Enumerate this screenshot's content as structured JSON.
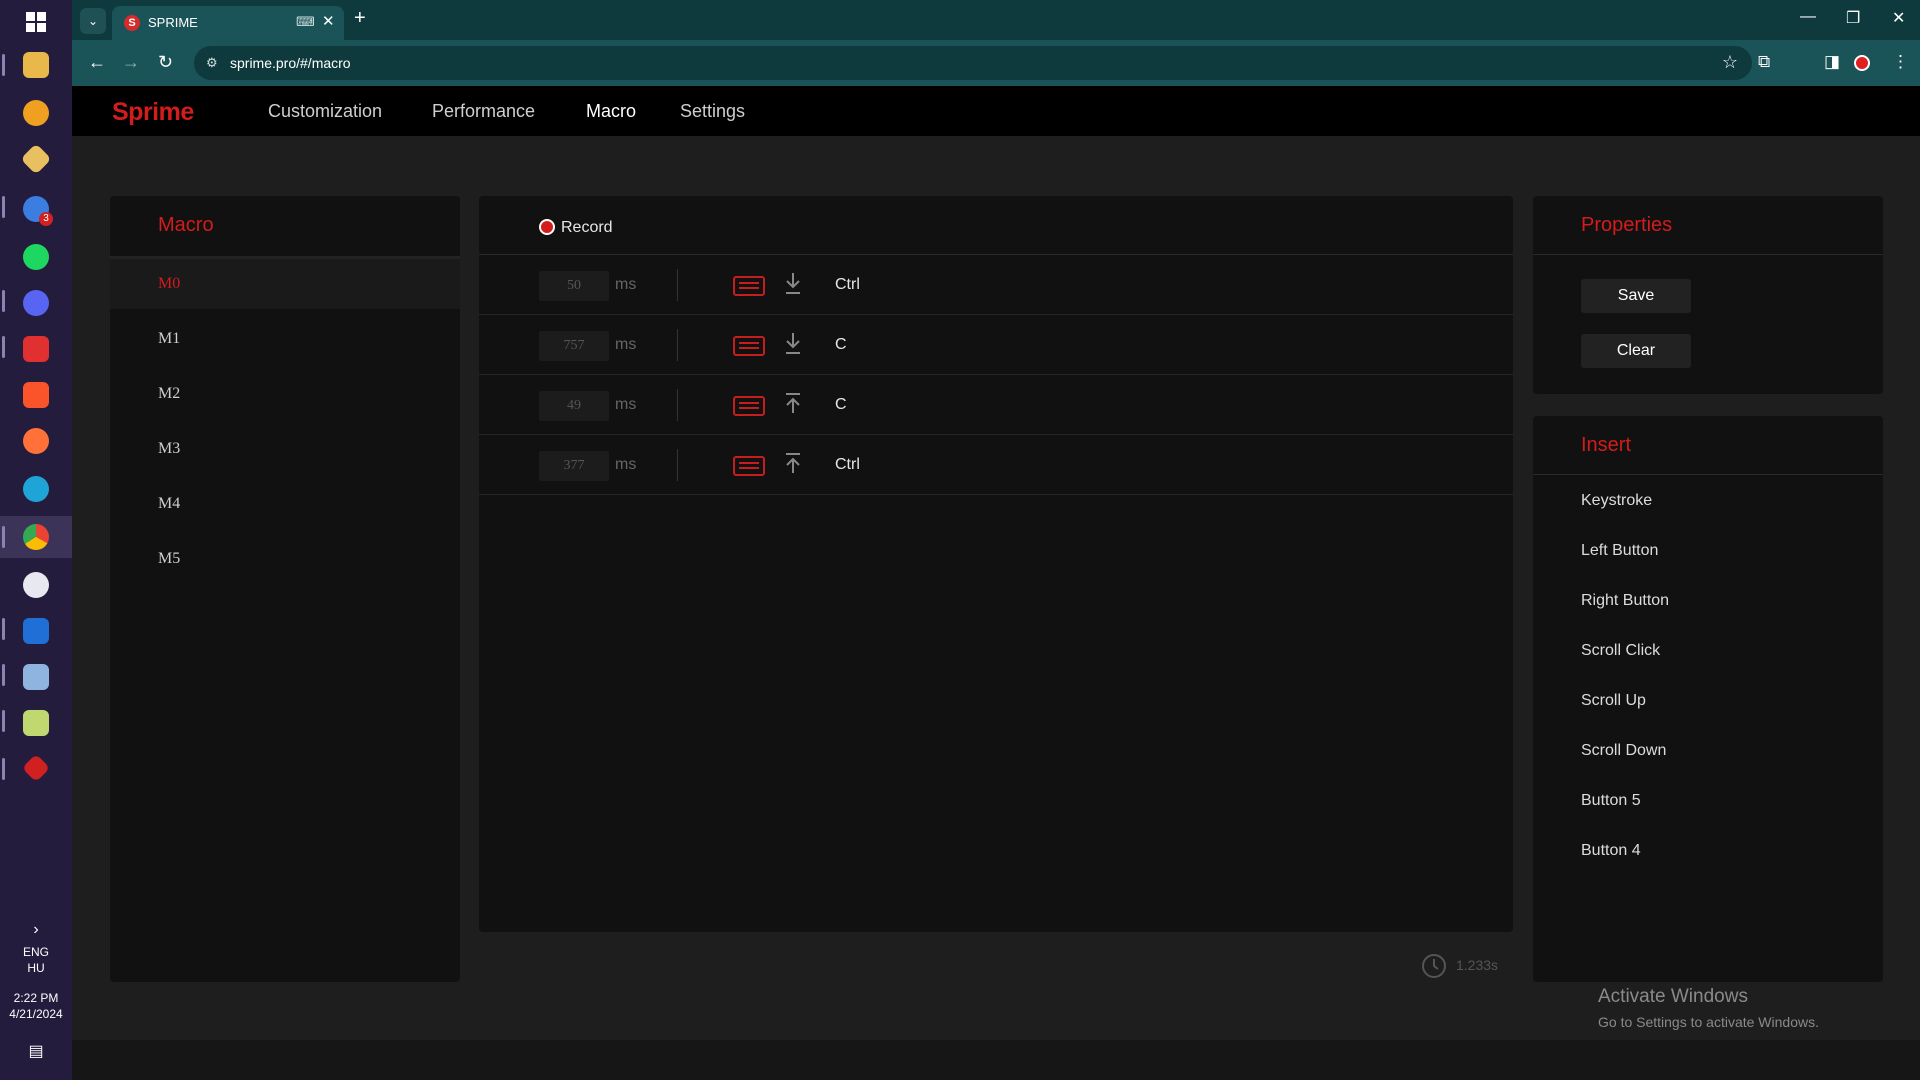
{
  "taskbar": {
    "language": "ENG",
    "region": "HU",
    "time": "2:22 PM",
    "date": "4/21/2024",
    "badge_count": "3"
  },
  "browser": {
    "tab_title": "SPRIME",
    "tab_favicon_letter": "S",
    "url": "sprime.pro/#/macro"
  },
  "app": {
    "logo": "Sprime",
    "nav": [
      {
        "label": "Customization"
      },
      {
        "label": "Performance"
      },
      {
        "label": "Macro"
      },
      {
        "label": "Settings"
      }
    ],
    "active_nav": "Macro",
    "accent_color": "#d31c1c"
  },
  "macro_panel": {
    "title": "Macro",
    "items": [
      "M0",
      "M1",
      "M2",
      "M3",
      "M4",
      "M5"
    ],
    "selected": "M0"
  },
  "editor": {
    "record_label": "Record",
    "rows": [
      {
        "delay": "50",
        "unit": "ms",
        "device": "keyboard-icon",
        "direction": "down",
        "key": "Ctrl"
      },
      {
        "delay": "757",
        "unit": "ms",
        "device": "keyboard-icon",
        "direction": "down",
        "key": "C"
      },
      {
        "delay": "49",
        "unit": "ms",
        "device": "keyboard-icon",
        "direction": "up",
        "key": "C"
      },
      {
        "delay": "377",
        "unit": "ms",
        "device": "keyboard-icon",
        "direction": "up",
        "key": "Ctrl"
      }
    ],
    "total_time": "1.233s"
  },
  "properties": {
    "title": "Properties",
    "save_label": "Save",
    "clear_label": "Clear"
  },
  "insert": {
    "title": "Insert",
    "items": [
      "Keystroke",
      "Left Button",
      "Right Button",
      "Scroll Click",
      "Scroll Up",
      "Scroll Down",
      "Button 5",
      "Button 4"
    ]
  },
  "watermark": {
    "line1": "Activate Windows",
    "line2": "Go to Settings to activate Windows."
  }
}
